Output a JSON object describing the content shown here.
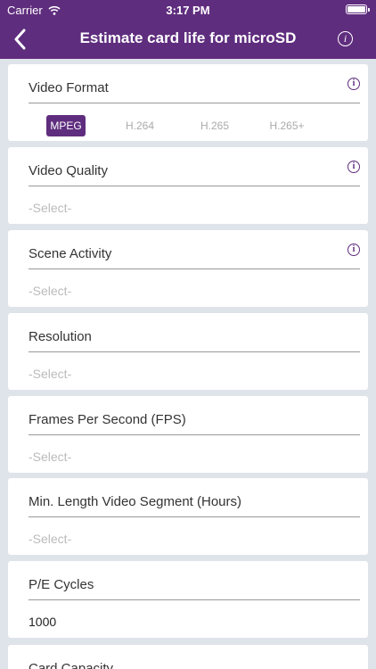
{
  "status_bar": {
    "carrier": "Carrier",
    "time": "3:17 PM"
  },
  "nav": {
    "title": "Estimate card life for microSD",
    "info_glyph": "i"
  },
  "icons": {
    "back": "chevron-left-icon",
    "wifi": "wifi-icon",
    "battery": "battery-icon",
    "info": "info-icon"
  },
  "colors": {
    "brand": "#5f2d7e",
    "background": "#dfe3ea",
    "placeholder": "#bbbbbb"
  },
  "video_format": {
    "label": "Video Format",
    "options": [
      "MPEG",
      "H.264",
      "H.265",
      "H.265+"
    ],
    "selected": "MPEG"
  },
  "fields": {
    "video_quality": {
      "label": "Video Quality",
      "value": "-Select-"
    },
    "scene_activity": {
      "label": "Scene Activity",
      "value": "-Select-"
    },
    "resolution": {
      "label": "Resolution",
      "value": "-Select-"
    },
    "fps": {
      "label": "Frames Per Second (FPS)",
      "value": "-Select-"
    },
    "min_segment": {
      "label": "Min. Length Video Segment (Hours)",
      "value": "-Select-"
    },
    "pe_cycles": {
      "label": "P/E Cycles",
      "value": "1000"
    },
    "card_capacity": {
      "label": "Card Capacity"
    }
  }
}
